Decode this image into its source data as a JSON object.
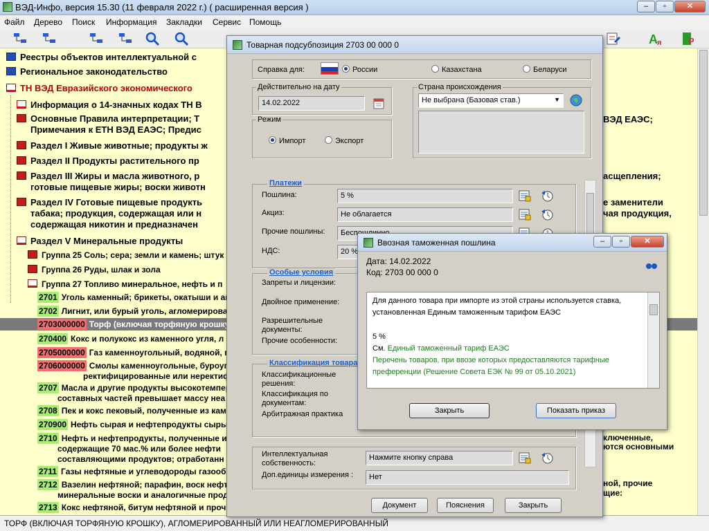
{
  "window": {
    "title": "ВЭД-Инфо, версия 15.30 (11 февраля 2022 г.)  ( расширенная версия )"
  },
  "menu": [
    "Файл",
    "Дерево",
    "Поиск",
    "Информация",
    "Закладки",
    "Сервис",
    "Помощь"
  ],
  "toolbar": {
    "icons": [
      "tree-back-icon",
      "tree-forward-icon",
      "tree-up-icon",
      "tree-down-icon",
      "search-icon",
      "bookmark-icon",
      "dictionary-icon",
      "translate-icon",
      "registry-icon"
    ]
  },
  "tree": {
    "rows": [
      {
        "text": "Реестры объектов интеллектуальной с"
      },
      {
        "text": "Региональное законодательство"
      },
      {
        "text": "ТН ВЭД Евразийского экономического"
      },
      {
        "text": "Информация о 14-значных кодах ТН В"
      },
      {
        "text": "Основные Правила интерпретации; Т",
        "text2": "Примечания к ЕТН ВЭД ЕАЭС; Предис"
      },
      {
        "text": "Раздел I Живые животные; продукты ж"
      },
      {
        "text": "Раздел II Продукты растительного пр"
      },
      {
        "text": "Раздел III Жиры и масла животного, р",
        "text2": "готовые пищевые жиры; воски животн"
      },
      {
        "text": "Раздел IV Готовые пищевые продукть",
        "text2": "табака; продукция, содержащая или н",
        "text3": "содержащая никотин и предназначен"
      },
      {
        "text": "Раздел V Минеральные продукты"
      },
      {
        "text": "Группа 25 Соль; сера; земли и камень; штук"
      },
      {
        "text": "Группа 26 Руды, шлак и зола"
      },
      {
        "text": "Группа 27 Топливо минеральное, нефть и п"
      }
    ],
    "codes": [
      {
        "code": "2701",
        "text": "Уголь каменный; брикеты, окатыши и ан"
      },
      {
        "code": "2702",
        "text": "Лигнит, или бурый уголь, агломерирова"
      },
      {
        "code": "2703000000",
        "text": "Торф (включая торфяную крошку),"
      },
      {
        "code": "270400",
        "text": "Кокс и полукокс из каменного угля, л"
      },
      {
        "code": "2705000000",
        "text": "Газ каменноугольный, водяной, ге"
      },
      {
        "code": "2706000000",
        "text": "Смолы каменноугольные, буроуго",
        "text2": "ректифицированные или неректиф"
      },
      {
        "code": "2707",
        "text": "Масла и другие продукты высокотемпер",
        "text2": "составных частей превышает массу неа"
      },
      {
        "code": "2708",
        "text": "Пек и кокс пековый, полученные из кам"
      },
      {
        "code": "270900",
        "text": "Нефть сырая и нефтепродукты сыры"
      },
      {
        "code": "2710",
        "text": "Нефть и нефтепродукты, полученные из",
        "text2": "содержащие 70 мас.% или более нефти",
        "text3": "составляющими продуктов; отработанн"
      },
      {
        "code": "2711",
        "text": "Газы нефтяные и углеводороды газообр"
      },
      {
        "code": "2712",
        "text": "Вазелин нефтяной; парафин, воск нефтя",
        "text2": "минеральные воски и аналогичные прод"
      },
      {
        "code": "2713",
        "text": "Кокс нефтяной, битум нефтяной и проч"
      }
    ],
    "right_fragments": [
      "ВЭД ЕАЭС;",
      "асщепления;",
      "е заменители",
      "чая продукция,",
      "ключенные,",
      "ются основными",
      "ной, прочие",
      "щие:"
    ]
  },
  "statusbar": {
    "text": "ТОРФ (ВКЛЮЧАЯ ТОРФЯНУЮ КРОШКУ), АГЛОМЕРИРОВАННЫЙ ИЛИ НЕАГЛОМЕРИРОВАННЫЙ"
  },
  "dialog1": {
    "title": "Товарная подсубпозиция 2703 00 000 0",
    "ref_label": "Справка для:",
    "countries": [
      "России",
      "Казахстана",
      "Беларуси"
    ],
    "date_group": "Действительно на дату",
    "date_value": "14.02.2022",
    "mode_group": "Режим",
    "mode_import": "Импорт",
    "mode_export": "Экспорт",
    "origin_group": "Страна происхождения",
    "origin_value": "Не выбрана (Базовая став.)",
    "payments_head": "Платежи",
    "duty_label": "Пошлина:",
    "duty_value": "5 %",
    "excise_label": "Акциз:",
    "excise_value": "Не облагается",
    "other_label": "Прочие пошлины:",
    "other_value": "Беспошлинно",
    "vat_label": "НДС:",
    "vat_value": "20 %",
    "special_head": "Особые условия",
    "ban_label": "Запреты и лицензии:",
    "dual_label": "Двойное применение:",
    "perm_label": "Разрешительные документы:",
    "other_feat_label": "Прочие особенности:",
    "class_head": "Классификация товара",
    "class_dec_label": "Классификационные решения:",
    "class_doc_label": "Классификация по документам:",
    "arb_label": "Арбитражная практика",
    "ip_label": "Интеллектуальная собственность:",
    "ip_value": "Нажмите кнопку справа",
    "units_label": "Доп.единицы измерения :",
    "units_value": "Нет",
    "btn_document": "Документ",
    "btn_notes": "Пояснения",
    "btn_close": "Закрыть"
  },
  "dialog2": {
    "title": "Ввозная таможенная пошлина",
    "date_line": "Дата: 14.02.2022",
    "code_line": "Код:  2703 00 000 0",
    "text1": "Для данного товара при импорте из этой страны используется ставка,",
    "text2": "установленная Единым таможенным тарифом ЕАЭС",
    "rate": "5 %",
    "see": "См.",
    "link1": "Единый таможенный тариф ЕАЭС",
    "link2": "Перечень товаров, при ввозе которых предоставляются тарифные",
    "link3": "преференции (Решение Совета ЕЭК № 99 от 05.10.2021)",
    "btn_close": "Закрыть",
    "btn_order": "Показать приказ"
  }
}
